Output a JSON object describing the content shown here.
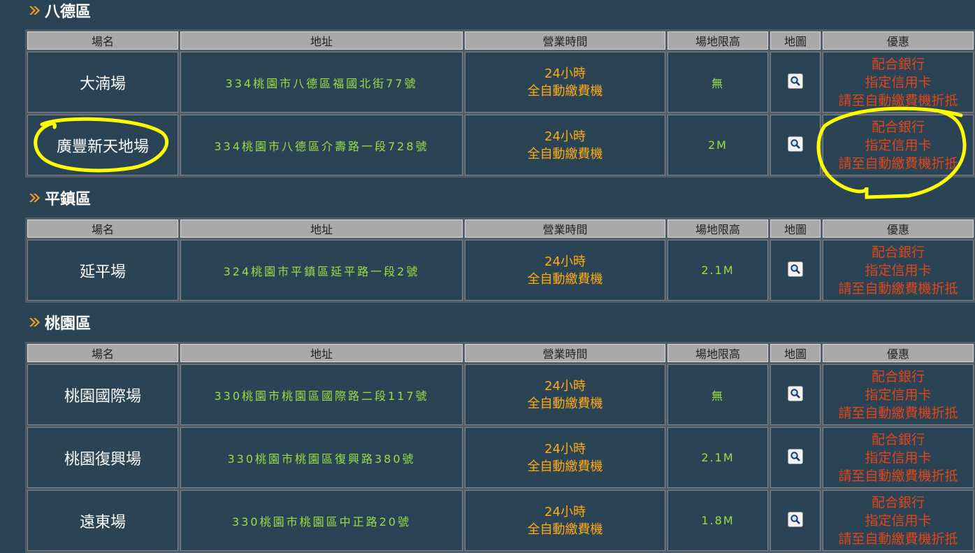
{
  "headers": {
    "name": "場名",
    "address": "地址",
    "hours": "營業時間",
    "height_limit": "場地限高",
    "map": "地圖",
    "promo": "優惠"
  },
  "icons": {
    "section_marker": "double-chevron-icon",
    "map": "magnifier-icon"
  },
  "colors": {
    "background": "#2b4455",
    "address": "#99dd44",
    "hours": "#ffaa11",
    "promo": "#e04418",
    "annotation": "#ffff00"
  },
  "sections": [
    {
      "title": "八德區",
      "rows": [
        {
          "name": "大湳場",
          "address": "334桃園市八德區福國北街77號",
          "hours": [
            "24小時",
            "全自動繳費機"
          ],
          "height_limit": "無",
          "promo": [
            "配合銀行",
            "指定信用卡",
            "請至自動繳費機折抵"
          ]
        },
        {
          "name": "廣豐新天地場",
          "address": "334桃園市八德區介壽路一段728號",
          "hours": [
            "24小時",
            "全自動繳費機"
          ],
          "height_limit": "2M",
          "promo": [
            "配合銀行",
            "指定信用卡",
            "請至自動繳費機折抵"
          ]
        }
      ]
    },
    {
      "title": "平鎮區",
      "rows": [
        {
          "name": "延平場",
          "address": "324桃園市平鎮區延平路一段2號",
          "hours": [
            "24小時",
            "全自動繳費機"
          ],
          "height_limit": "2.1M",
          "promo": [
            "配合銀行",
            "指定信用卡",
            "請至自動繳費機折抵"
          ]
        }
      ]
    },
    {
      "title": "桃園區",
      "rows": [
        {
          "name": "桃園國際場",
          "address": "330桃園市桃園區國際路二段117號",
          "hours": [
            "24小時",
            "全自動繳費機"
          ],
          "height_limit": "無",
          "promo": [
            "配合銀行",
            "指定信用卡",
            "請至自動繳費機折抵"
          ]
        },
        {
          "name": "桃園復興場",
          "address": "330桃園市桃園區復興路380號",
          "hours": [
            "24小時",
            "全自動繳費機"
          ],
          "height_limit": "2.1M",
          "promo": [
            "配合銀行",
            "指定信用卡",
            "請至自動繳費機折抵"
          ]
        },
        {
          "name": "遠東場",
          "address": "330桃園市桃園區中正路20號",
          "hours": [
            "24小時",
            "全自動繳費機"
          ],
          "height_limit": "1.8M",
          "promo": [
            "配合銀行",
            "指定信用卡",
            "請至自動繳費機折抵"
          ]
        }
      ]
    }
  ]
}
